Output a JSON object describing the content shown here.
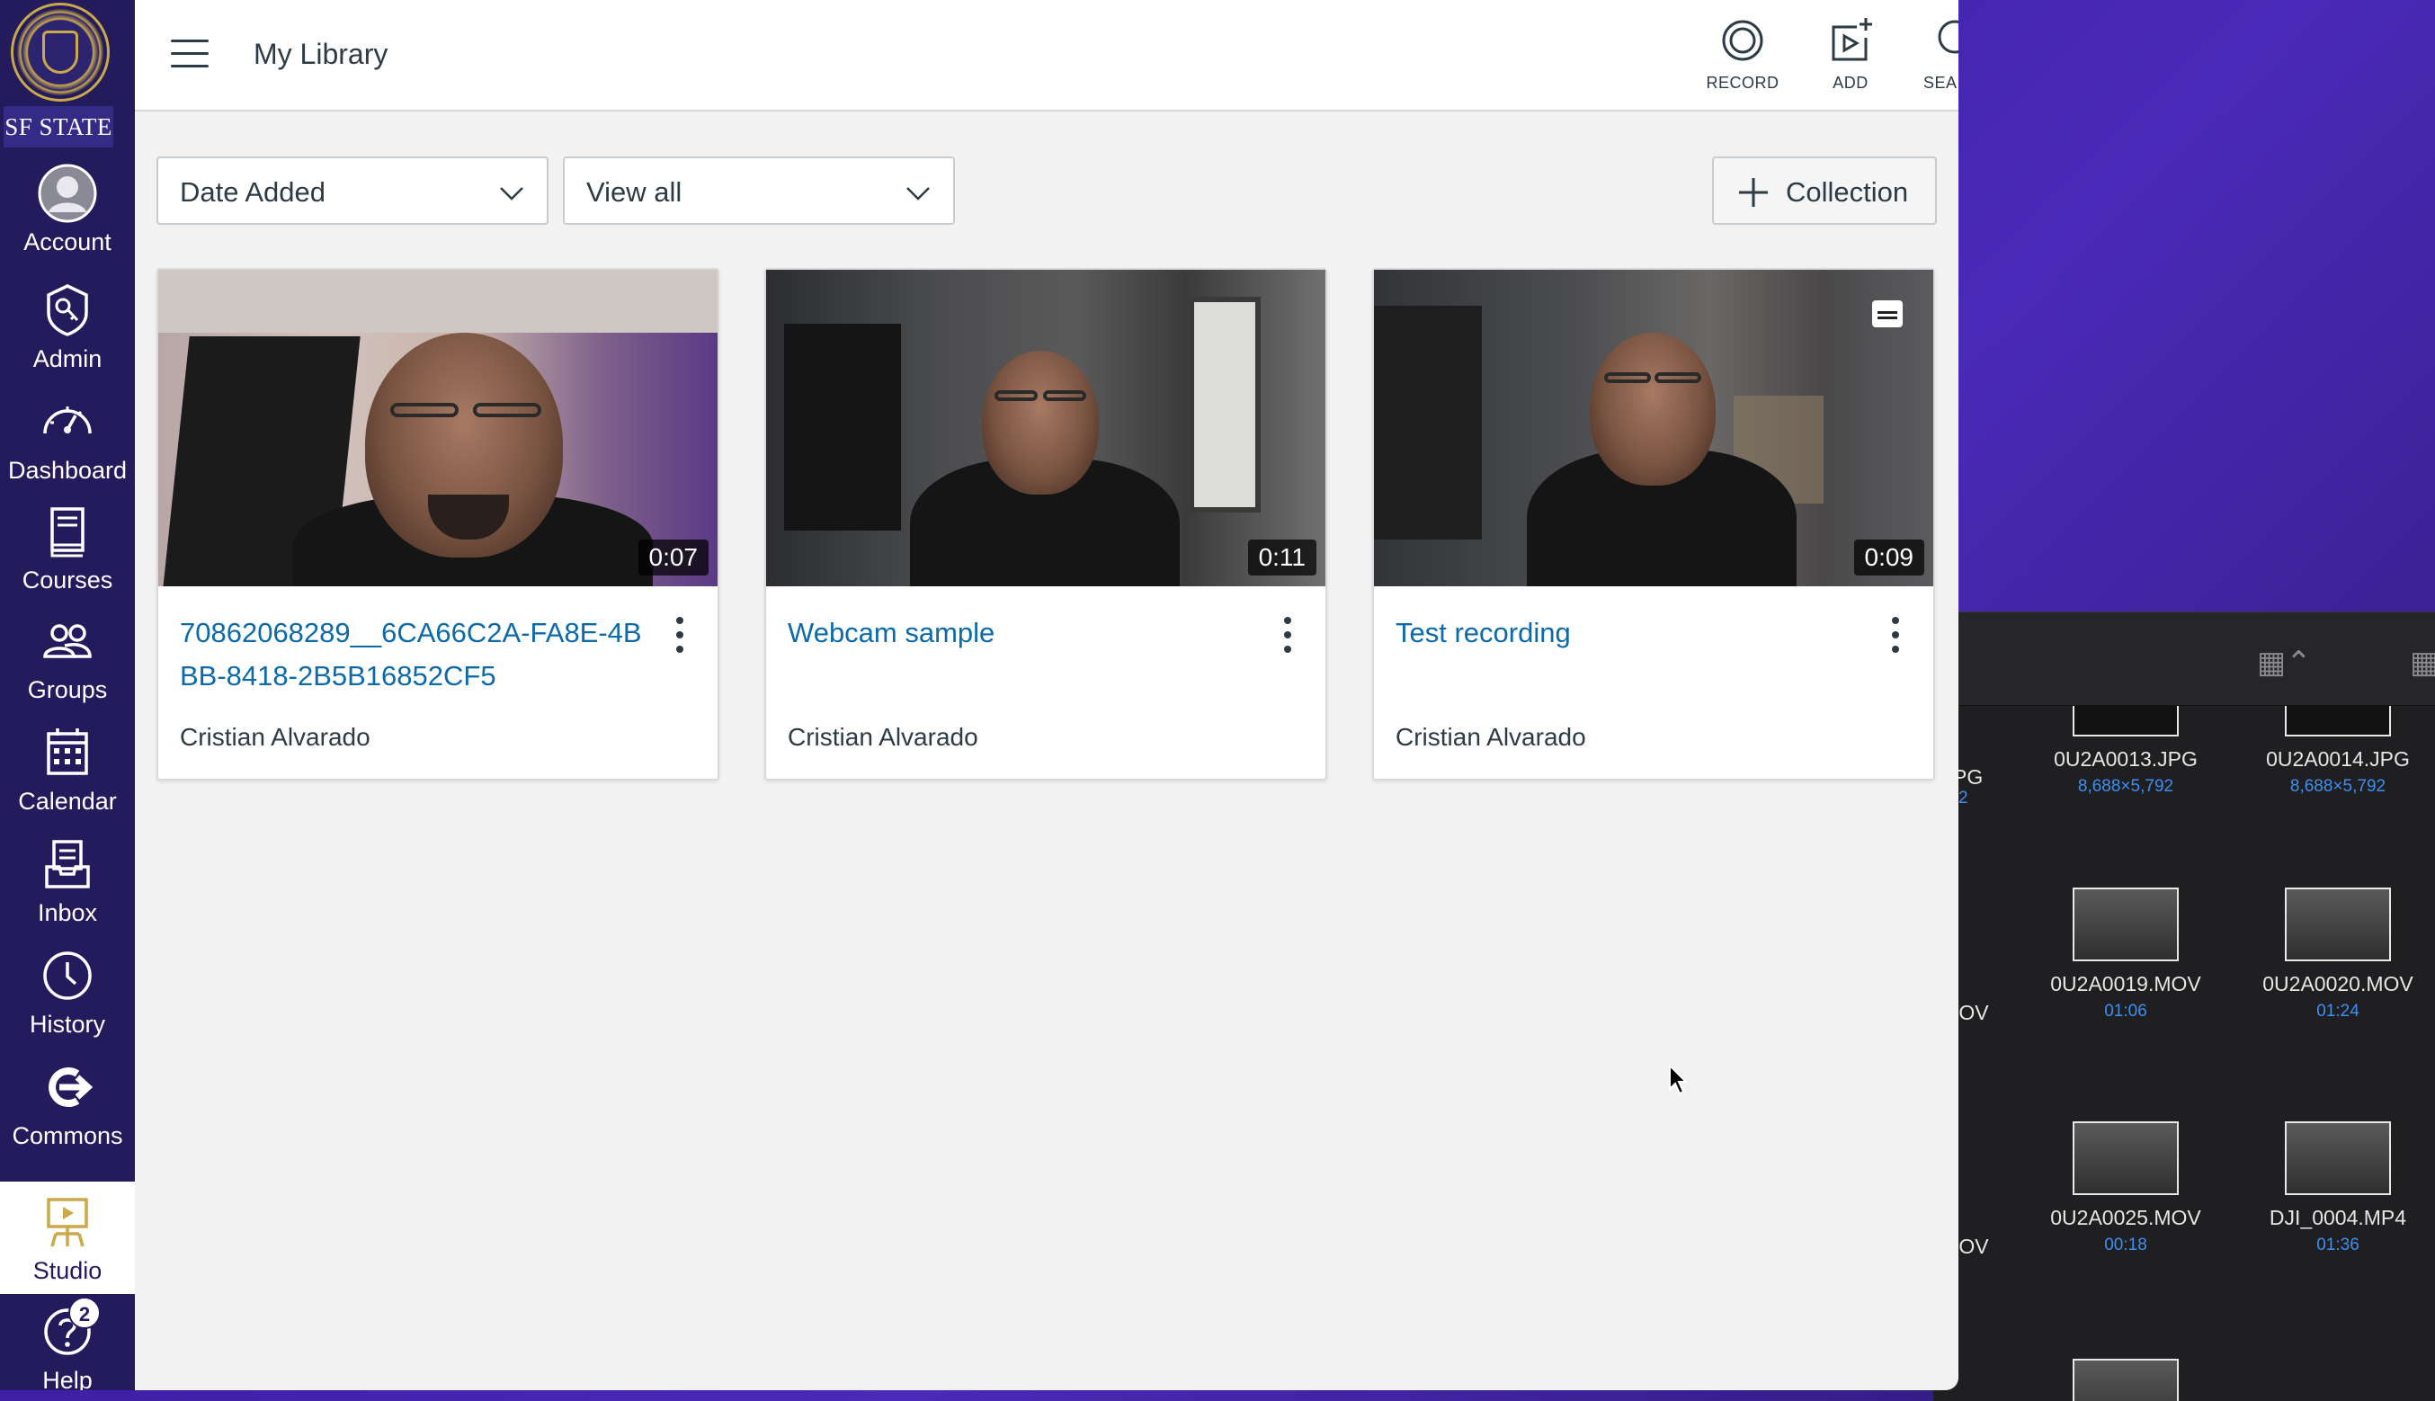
{
  "header": {
    "title": "My Library",
    "actions": {
      "record": "RECORD",
      "add": "ADD",
      "search": "SEARCH"
    }
  },
  "logo": {
    "text": "SF STATE"
  },
  "nav": {
    "items": [
      {
        "label": "Account",
        "icon": "avatar-icon"
      },
      {
        "label": "Admin",
        "icon": "shield-key-icon"
      },
      {
        "label": "Dashboard",
        "icon": "speedometer-icon"
      },
      {
        "label": "Courses",
        "icon": "book-icon"
      },
      {
        "label": "Groups",
        "icon": "people-icon"
      },
      {
        "label": "Calendar",
        "icon": "calendar-icon"
      },
      {
        "label": "Inbox",
        "icon": "inbox-icon"
      },
      {
        "label": "History",
        "icon": "clock-icon"
      },
      {
        "label": "Commons",
        "icon": "commons-arrow-icon"
      },
      {
        "label": "Studio",
        "icon": "studio-easel-icon"
      },
      {
        "label": "Help",
        "icon": "help-question-icon"
      }
    ],
    "active": "Studio",
    "help_badge": "2"
  },
  "toolbar": {
    "sort": {
      "value": "Date Added"
    },
    "filter": {
      "value": "View all"
    },
    "collection_button": "Collection"
  },
  "cards": [
    {
      "title": "70862068289__6CA66C2A-FA8E-4BBB-8418-2B5B16852CF5",
      "duration": "0:07",
      "owner": "Cristian Alvarado",
      "captions": false
    },
    {
      "title": "Webcam sample",
      "duration": "0:11",
      "owner": "Cristian Alvarado",
      "captions": false
    },
    {
      "title": "Test recording",
      "duration": "0:09",
      "owner": "Cristian Alvarado",
      "captions": true
    }
  ],
  "finder": {
    "items": [
      {
        "name": "0U2A0013.JPG",
        "meta": "8,688×5,792"
      },
      {
        "name": "0U2A0014.JPG",
        "meta": "8,688×5,792"
      },
      {
        "name": "0U2A0019.MOV",
        "meta": "01:06"
      },
      {
        "name": "0U2A0020.MOV",
        "meta": "01:24"
      },
      {
        "name": "0U2A0025.MOV",
        "meta": "00:18"
      },
      {
        "name": "DJI_0004.MP4",
        "meta": "01:36"
      }
    ],
    "cut_labels": [
      "PG",
      "2",
      "IOV",
      "IOV"
    ]
  },
  "colors": {
    "nav_bg": "#231b5c",
    "link": "#0d6aa8",
    "text": "#2d3b45",
    "gold": "#c9a94a"
  }
}
